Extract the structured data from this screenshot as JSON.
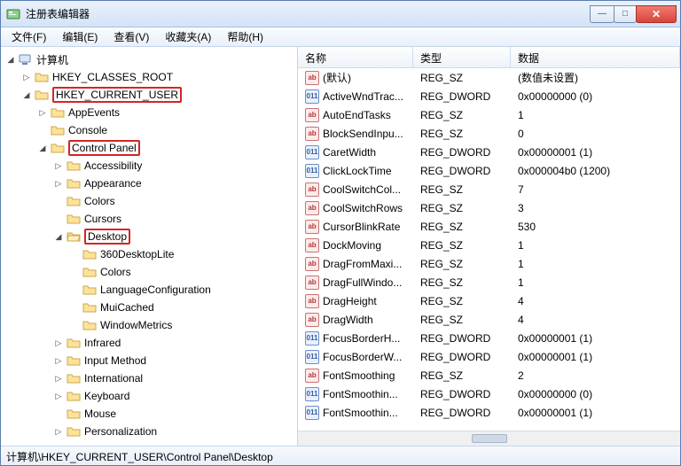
{
  "window": {
    "title": "注册表编辑器"
  },
  "menu": {
    "file": "文件(F)",
    "edit": "编辑(E)",
    "view": "查看(V)",
    "favorites": "收藏夹(A)",
    "help": "帮助(H)"
  },
  "tree": {
    "root": "计算机",
    "hcr": "HKEY_CLASSES_ROOT",
    "hcu": "HKEY_CURRENT_USER",
    "appevents": "AppEvents",
    "console": "Console",
    "controlpanel": "Control Panel",
    "accessibility": "Accessibility",
    "appearance": "Appearance",
    "colors": "Colors",
    "cursors": "Cursors",
    "desktop": "Desktop",
    "desklite": "360DesktopLite",
    "colors2": "Colors",
    "langconf": "LanguageConfiguration",
    "muicached": "MuiCached",
    "winmetrics": "WindowMetrics",
    "infrared": "Infrared",
    "inputmethod": "Input Method",
    "international": "International",
    "keyboard": "Keyboard",
    "mouse": "Mouse",
    "personalization": "Personalization"
  },
  "columns": {
    "name": "名称",
    "type": "类型",
    "data": "数据"
  },
  "values": [
    {
      "name": "(默认)",
      "type": "REG_SZ",
      "data": "(数值未设置)",
      "icon": "sz"
    },
    {
      "name": "ActiveWndTrac...",
      "type": "REG_DWORD",
      "data": "0x00000000 (0)",
      "icon": "dw"
    },
    {
      "name": "AutoEndTasks",
      "type": "REG_SZ",
      "data": "1",
      "icon": "sz"
    },
    {
      "name": "BlockSendInpu...",
      "type": "REG_SZ",
      "data": "0",
      "icon": "sz"
    },
    {
      "name": "CaretWidth",
      "type": "REG_DWORD",
      "data": "0x00000001 (1)",
      "icon": "dw"
    },
    {
      "name": "ClickLockTime",
      "type": "REG_DWORD",
      "data": "0x000004b0 (1200)",
      "icon": "dw"
    },
    {
      "name": "CoolSwitchCol...",
      "type": "REG_SZ",
      "data": "7",
      "icon": "sz"
    },
    {
      "name": "CoolSwitchRows",
      "type": "REG_SZ",
      "data": "3",
      "icon": "sz"
    },
    {
      "name": "CursorBlinkRate",
      "type": "REG_SZ",
      "data": "530",
      "icon": "sz"
    },
    {
      "name": "DockMoving",
      "type": "REG_SZ",
      "data": "1",
      "icon": "sz"
    },
    {
      "name": "DragFromMaxi...",
      "type": "REG_SZ",
      "data": "1",
      "icon": "sz"
    },
    {
      "name": "DragFullWindo...",
      "type": "REG_SZ",
      "data": "1",
      "icon": "sz"
    },
    {
      "name": "DragHeight",
      "type": "REG_SZ",
      "data": "4",
      "icon": "sz"
    },
    {
      "name": "DragWidth",
      "type": "REG_SZ",
      "data": "4",
      "icon": "sz"
    },
    {
      "name": "FocusBorderH...",
      "type": "REG_DWORD",
      "data": "0x00000001 (1)",
      "icon": "dw"
    },
    {
      "name": "FocusBorderW...",
      "type": "REG_DWORD",
      "data": "0x00000001 (1)",
      "icon": "dw"
    },
    {
      "name": "FontSmoothing",
      "type": "REG_SZ",
      "data": "2",
      "icon": "sz"
    },
    {
      "name": "FontSmoothin...",
      "type": "REG_DWORD",
      "data": "0x00000000 (0)",
      "icon": "dw"
    },
    {
      "name": "FontSmoothin...",
      "type": "REG_DWORD",
      "data": "0x00000001 (1)",
      "icon": "dw"
    }
  ],
  "statusbar": "计算机\\HKEY_CURRENT_USER\\Control Panel\\Desktop",
  "icon_labels": {
    "sz": "ab",
    "dw": "011"
  }
}
